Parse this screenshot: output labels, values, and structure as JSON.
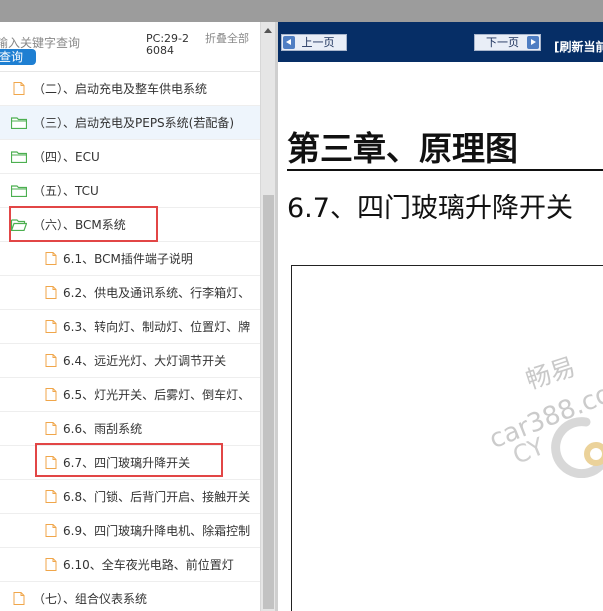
{
  "sidebar": {
    "search_placeholder": "输入关键字查询",
    "query_button": "查询",
    "pc_code": "PC:29-26084",
    "fold_all": "折叠全部",
    "items": [
      {
        "label": "（二）、启动充电及整车供电系统"
      },
      {
        "label": "（三）、启动充电及PEPS系统(若配备)"
      },
      {
        "label": "（四）、ECU"
      },
      {
        "label": "（五）、TCU"
      },
      {
        "label": "（六）、BCM系统"
      },
      {
        "label": "6.1、BCM插件端子说明"
      },
      {
        "label": "6.2、供电及通讯系统、行李箱灯、"
      },
      {
        "label": "6.3、转向灯、制动灯、位置灯、牌"
      },
      {
        "label": "6.4、远近光灯、大灯调节开关"
      },
      {
        "label": "6.5、灯光开关、后雾灯、倒车灯、"
      },
      {
        "label": "6.6、雨刮系统"
      },
      {
        "label": "6.7、四门玻璃升降开关"
      },
      {
        "label": "6.8、门锁、后背门开启、接触开关"
      },
      {
        "label": "6.9、四门玻璃升降电机、除霜控制"
      },
      {
        "label": "6.10、全车夜光电路、前位置灯"
      },
      {
        "label": "（七）、组合仪表系统"
      }
    ]
  },
  "toolbar": {
    "prev_label": "上一页",
    "next_label": "下一页",
    "refresh_label": "[刷新当前"
  },
  "document": {
    "chapter_title": "第三章、原理图",
    "section_title": "6.7、四门玻璃升降开关",
    "watermark_line1": "畅易",
    "watermark_line2": "car388.co",
    "watermark_line3": "CY"
  },
  "colors": {
    "navbar_bg": "#062e66",
    "query_button_bg": "#1e7fd2",
    "highlight_box": "#e24646",
    "folder_green": "#4caf50",
    "file_orange": "#f0a64a"
  }
}
